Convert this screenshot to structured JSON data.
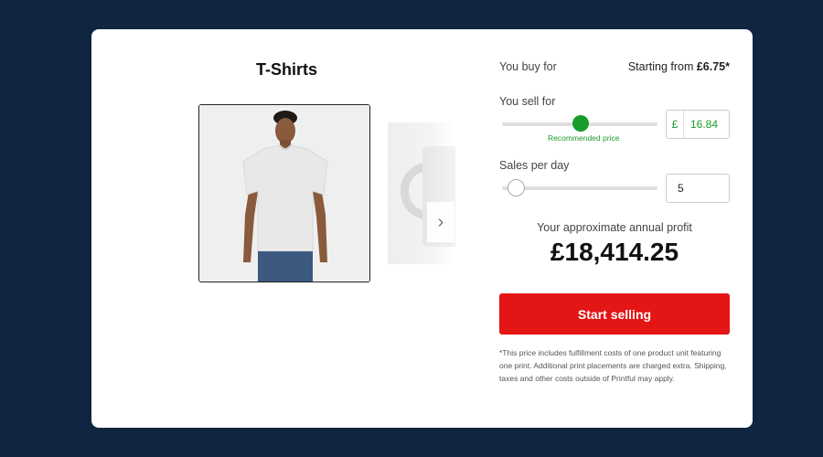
{
  "product": {
    "title": "T-Shirts",
    "main_image": "t-shirt-model-photo",
    "next_image": "mug-photo",
    "next_icon": "chevron-right-icon"
  },
  "pricing": {
    "buy_label": "You buy for",
    "buy_prefix": "Starting from ",
    "buy_amount": "£6.75*",
    "sell_label": "You sell for",
    "currency": "£",
    "sell_price": "16.84",
    "recommended_label": "Recommended price",
    "sales_label": "Sales per day",
    "sales_per_day": "5",
    "profit_label": "Your approximate annual profit",
    "profit_value": "£18,414.25",
    "cta_label": "Start selling",
    "disclaimer": "*This price includes fulfillment costs of one product unit featuring one print. Additional print placements are charged extra. Shipping, taxes and other costs outside of Printful may apply."
  },
  "colors": {
    "background": "#0f2540",
    "accent_green": "#1a9c2a",
    "cta_red": "#e31515"
  }
}
